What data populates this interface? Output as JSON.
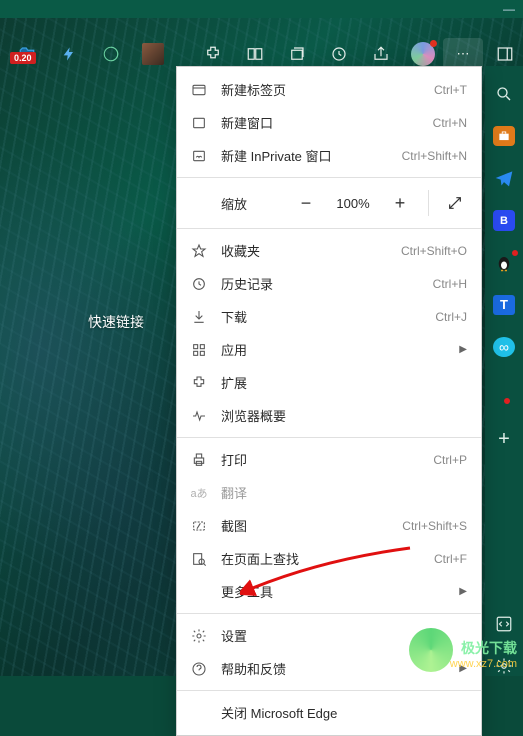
{
  "toolbar": {
    "badge": "0.20",
    "quicklinks_label": "快速链接"
  },
  "menu": {
    "new_tab": {
      "label": "新建标签页",
      "shortcut": "Ctrl+T"
    },
    "new_window": {
      "label": "新建窗口",
      "shortcut": "Ctrl+N"
    },
    "new_inprivate": {
      "label": "新建 InPrivate 窗口",
      "shortcut": "Ctrl+Shift+N"
    },
    "zoom": {
      "label": "缩放",
      "value": "100%"
    },
    "favorites": {
      "label": "收藏夹",
      "shortcut": "Ctrl+Shift+O"
    },
    "history": {
      "label": "历史记录",
      "shortcut": "Ctrl+H"
    },
    "downloads": {
      "label": "下载",
      "shortcut": "Ctrl+J"
    },
    "apps": {
      "label": "应用"
    },
    "extensions": {
      "label": "扩展"
    },
    "browser_overview": {
      "label": "浏览器概要"
    },
    "print": {
      "label": "打印",
      "shortcut": "Ctrl+P"
    },
    "translate": {
      "label": "翻译"
    },
    "screenshot": {
      "label": "截图",
      "shortcut": "Ctrl+Shift+S"
    },
    "find": {
      "label": "在页面上查找",
      "shortcut": "Ctrl+F"
    },
    "more_tools": {
      "label": "更多工具"
    },
    "settings": {
      "label": "设置"
    },
    "help": {
      "label": "帮助和反馈"
    },
    "close": {
      "label": "关闭 Microsoft Edge"
    }
  },
  "watermark": {
    "line1": "极光下载",
    "line2": "www.xz7.com"
  }
}
